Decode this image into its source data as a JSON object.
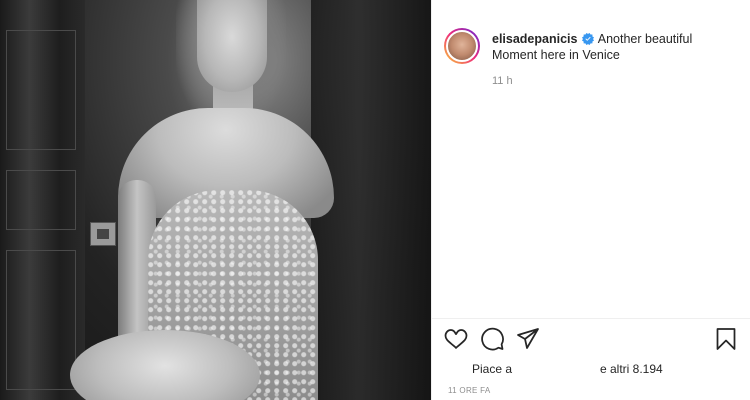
{
  "post": {
    "photo_alt": "photo",
    "author": {
      "username": "elisadepanicis",
      "verified": true,
      "avatar_icon": "avatar-photo"
    },
    "caption_line1": "Another beautiful",
    "caption_line2": "Moment here in Venice",
    "comment_time": "11 h",
    "actions": {
      "like_icon": "heart-icon",
      "comment_icon": "comment-bubble-icon",
      "share_icon": "paper-plane-icon",
      "save_icon": "bookmark-icon"
    },
    "likes_prefix": "Piace a",
    "likes_suffix": "e altri 8.194",
    "posted_ago": "11 ORE FA"
  },
  "colors": {
    "verified_blue": "#3897f0",
    "text": "#262626",
    "muted": "#8e8e8e",
    "border": "#efefef"
  }
}
